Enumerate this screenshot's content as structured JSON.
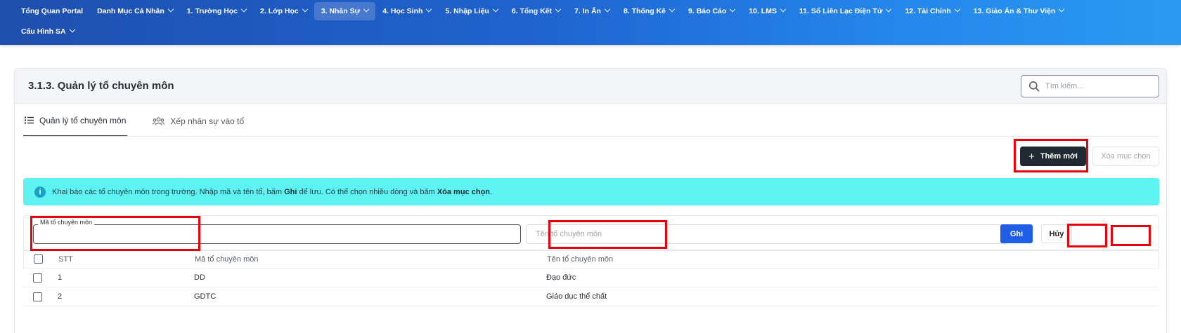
{
  "nav": {
    "row1": [
      {
        "label": "Tổng Quan Portal",
        "dropdown": false,
        "active": false
      },
      {
        "label": "Danh Mục Cá Nhân",
        "dropdown": true,
        "active": false
      },
      {
        "label": "1. Trường Học",
        "dropdown": true,
        "active": false
      },
      {
        "label": "2. Lớp Học",
        "dropdown": true,
        "active": false
      },
      {
        "label": "3. Nhân Sự",
        "dropdown": true,
        "active": true
      },
      {
        "label": "4. Học Sinh",
        "dropdown": true,
        "active": false
      },
      {
        "label": "5. Nhập Liệu",
        "dropdown": true,
        "active": false
      },
      {
        "label": "6. Tổng Kết",
        "dropdown": true,
        "active": false
      },
      {
        "label": "7. In Ấn",
        "dropdown": true,
        "active": false
      },
      {
        "label": "8. Thống Kê",
        "dropdown": true,
        "active": false
      },
      {
        "label": "9. Báo Cáo",
        "dropdown": true,
        "active": false
      },
      {
        "label": "10. LMS",
        "dropdown": true,
        "active": false
      },
      {
        "label": "11. Sổ Liên Lạc Điện Tử",
        "dropdown": true,
        "active": false
      },
      {
        "label": "12. Tài Chính",
        "dropdown": true,
        "active": false
      },
      {
        "label": "13. Giáo Án & Thư Viện",
        "dropdown": true,
        "active": false
      }
    ],
    "row2": [
      {
        "label": "Cấu Hình SA",
        "dropdown": true,
        "active": false
      }
    ]
  },
  "page": {
    "title": "3.1.3. Quản lý tổ chuyên môn",
    "search_placeholder": "Tìm kiếm..."
  },
  "tabs": [
    {
      "label": "Quản lý tổ chuyên môn",
      "icon": "list-icon",
      "active": true
    },
    {
      "label": "Xếp nhân sự vào tổ",
      "icon": "users-icon",
      "active": false
    }
  ],
  "actions": {
    "add_label": "Thêm mới",
    "delete_label": "Xóa mục chọn"
  },
  "alert": {
    "text_1": "Khai báo các tổ chuyên môn trong trường. Nhập mã và tên tổ, bấm ",
    "bold_1": "Ghi",
    "text_2": " để lưu. Có thể chọn nhiều dòng và bấm ",
    "bold_2": "Xóa mục chọn",
    "text_3": "."
  },
  "form": {
    "code_label": "Mã tổ chuyên môn",
    "code_value": "",
    "name_placeholder": "Tên tổ chuyên môn",
    "name_value": "",
    "save_label": "Ghi",
    "cancel_label": "Hủy"
  },
  "table": {
    "headers": {
      "stt": "STT",
      "code": "Mã tổ chuyên môn",
      "name": "Tên tổ chuyên môn"
    },
    "rows": [
      {
        "stt": "1",
        "code": "DD",
        "name": "Đạo đức"
      },
      {
        "stt": "2",
        "code": "GDTC",
        "name": "Giáo dục thể chất"
      }
    ]
  },
  "colors": {
    "nav_gradient_start": "#1e4fae",
    "nav_gradient_end": "#2a99f3",
    "alert_bg": "#5ef2f2",
    "primary_button": "#1f5fe6",
    "dark_button": "#212932",
    "highlight": "#e8000b"
  }
}
